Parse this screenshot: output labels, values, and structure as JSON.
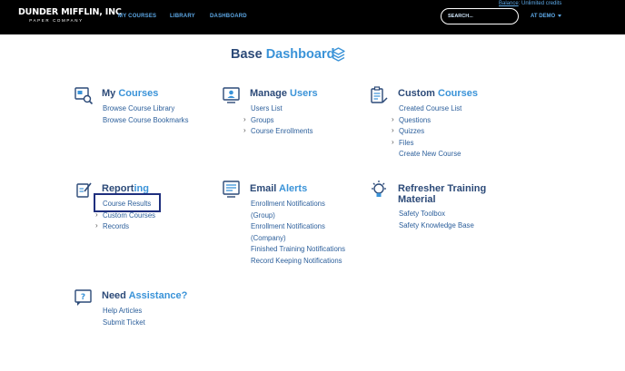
{
  "header": {
    "logo_main": "DUNDER MIFFLIN, INC",
    "logo_sub": "PAPER COMPANY",
    "nav": [
      "MY COURSES",
      "LIBRARY",
      "DASHBOARD"
    ],
    "balance_label": "Balance",
    "credits_text": ": Unlimited credits",
    "search_placeholder": "SEARCH...",
    "user_menu": "AT DEMO"
  },
  "page_title": {
    "part1": "Base",
    "part2": "Dashboard"
  },
  "sections": {
    "my_courses": {
      "title1": "My",
      "title2": "Courses",
      "items": [
        "Browse Course Library",
        "Browse Course Bookmarks"
      ]
    },
    "manage_users": {
      "title1": "Manage",
      "title2": "Users",
      "items": [
        "Users List",
        "Groups",
        "Course Enrollments"
      ]
    },
    "custom_courses": {
      "title1": "Custom",
      "title2": "Courses",
      "items": [
        "Created Course List",
        "Questions",
        "Quizzes",
        "Files",
        "Create New Course"
      ]
    },
    "reporting": {
      "title1": "Report",
      "title2": "ing",
      "items": [
        "Course Results",
        "Custom Courses",
        "Records"
      ]
    },
    "email_alerts": {
      "title1": "Email",
      "title2": "Alerts",
      "items": [
        "Enrollment Notifications",
        "(Group)",
        "Enrollment Notifications",
        "(Company)",
        "Finished Training Notifications",
        "Record Keeping Notifications"
      ]
    },
    "refresher": {
      "title_line1": "Refresher Training",
      "title_line2": "Material",
      "items": [
        "Safety Toolbox",
        "Safety Knowledge Base"
      ]
    },
    "assistance": {
      "title1": "Need",
      "title2": "Assistance?",
      "items": [
        "Help Articles",
        "Submit Ticket"
      ]
    }
  },
  "colors": {
    "brand_dark": "#2c4a78",
    "brand_accent": "#3a93d8",
    "link": "#2c5f9b",
    "nav": "#5da8e6",
    "highlight": "#1f2f7e"
  }
}
